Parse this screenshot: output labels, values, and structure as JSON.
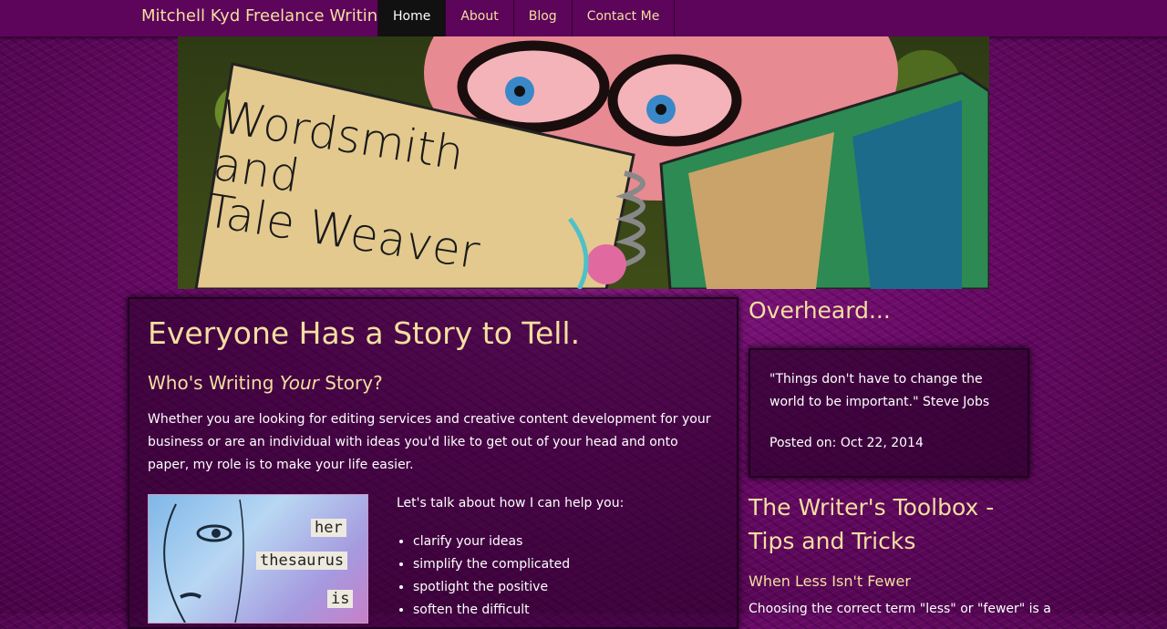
{
  "navbar": {
    "brand": "Mitchell Kyd Freelance Writing",
    "items": [
      {
        "label": "Home",
        "active": true
      },
      {
        "label": "About",
        "active": false
      },
      {
        "label": "Blog",
        "active": false
      },
      {
        "label": "Contact Me",
        "active": false
      }
    ]
  },
  "hero": {
    "text": "Wordsmith\nand\nTale Weaver"
  },
  "main": {
    "title": "Everyone Has a Story to Tell.",
    "subtitle_pre": "Who's Writing ",
    "subtitle_em": "Your",
    "subtitle_post": " Story?",
    "intro": "Whether you are looking for editing services and creative content development for your business or are an individual with ideas you'd like to get out of your head and onto paper, my role is to make your life easier.",
    "image_words": [
      "her",
      "thesaurus",
      "is"
    ],
    "help_intro": "Let's talk about how I can help you:",
    "help_items": [
      "clarify your ideas",
      "simplify the complicated",
      "spotlight the positive",
      "soften the difficult"
    ]
  },
  "sidebar": {
    "overheard_title": "Overheard...",
    "quote": "\"Things don't have to change the world to be important.\" Steve Jobs",
    "posted": "Posted on: Oct 22, 2014",
    "toolbox_title": "The Writer's Toolbox - Tips and Tricks",
    "post_title": "When Less Isn't Fewer",
    "post_snippet": "Choosing the correct term \"less\" or \"fewer\" is a"
  },
  "colors": {
    "accent": "#f3dfa0",
    "nav_bg": "#5c055b",
    "page_bg": "#6a0a68",
    "active_nav": "#111111"
  }
}
